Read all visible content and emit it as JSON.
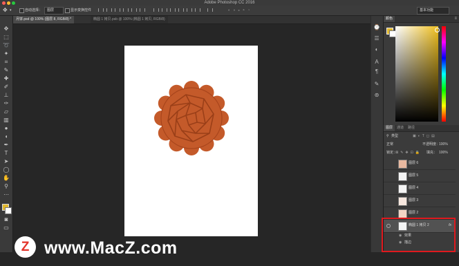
{
  "app": {
    "window_title": "Adobe Photoshop CC 2016"
  },
  "options_bar": {
    "auto_select_label": "自动选择：",
    "auto_select_value": "图层",
    "show_transform_label": "显示变换控件",
    "workspace_value": "基本功能"
  },
  "document_tabs": [
    {
      "label": "月饼.psd @ 100% (图层 8, RGB/8) *",
      "active": true
    },
    {
      "label": "椭圆 1 拷贝.psb @ 100% (椭圆 1 拷贝, RGB/8)",
      "active": false
    }
  ],
  "color_panel": {
    "tabs": [
      "颜色"
    ],
    "foreground_color": "#e2b92f",
    "background_color": "#ffffff"
  },
  "layers_panel": {
    "tabs": [
      "图层",
      "通道",
      "路径"
    ],
    "filter_label": "类型",
    "blend_mode": "正常",
    "opacity_label": "不透明度：",
    "opacity_value": "100%",
    "lock_label": "锁定：",
    "fill_label": "填充：",
    "fill_value": "100%",
    "layers": [
      {
        "name": "图层 6"
      },
      {
        "name": "图层 5"
      },
      {
        "name": "图层 4"
      },
      {
        "name": "图层 3"
      },
      {
        "name": "图层 2"
      },
      {
        "name": "椭圆 1 拷贝 2",
        "selected": true,
        "fx": "fx"
      }
    ],
    "effects_label": "效果",
    "stroke_label": "描边"
  },
  "watermark": {
    "logo_letter": "Z",
    "text": "www.MacZ.com"
  },
  "colors": {
    "accent_red": "#e0191e",
    "mooncake": "#c45a2a"
  }
}
